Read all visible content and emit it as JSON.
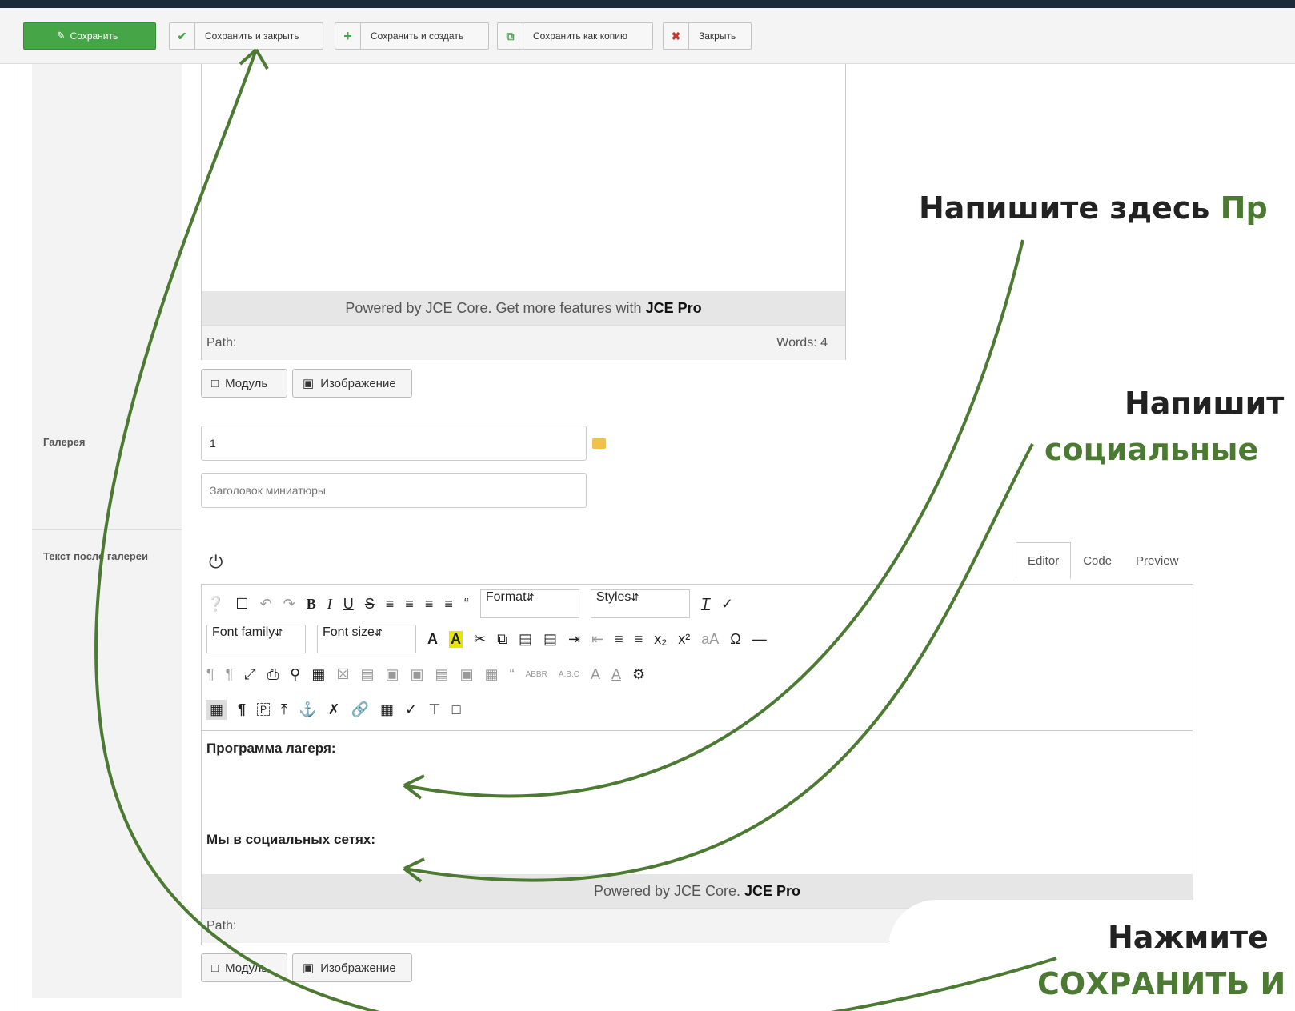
{
  "toolbar": {
    "save": "Сохранить",
    "save_close": "Сохранить и закрыть",
    "save_new": "Сохранить и создать",
    "save_copy": "Сохранить как копию",
    "close": "Закрыть"
  },
  "editor_top": {
    "powered_text": "Powered by JCE Core. Get more features with",
    "powered_bold": "JCE Pro",
    "path_label": "Path:",
    "words": "Words: 4"
  },
  "buttons": {
    "module": "Модуль",
    "image": "Изображение"
  },
  "gallery": {
    "label": "Галерея",
    "value": "1",
    "thumb_placeholder": "Заголовок миниатюры"
  },
  "after_gallery": {
    "label": "Текст после галереи",
    "tabs": [
      "Editor",
      "Code",
      "Preview"
    ],
    "format_select": "Format",
    "styles_select": "Styles",
    "font_family_select": "Font family",
    "font_size_select": "Font size",
    "content_line1": "Программа лагеря:",
    "content_line2": "Мы в социальных сетях:",
    "powered_text": "Powered by JCE Core.",
    "powered_bold": "JCE Pro",
    "path_label": "Path:"
  },
  "annotations": {
    "a1_black": "Напишите здесь ",
    "a1_green": "Пр",
    "a2_black": "Напишит",
    "a2_green": "социальные",
    "a3_black": "Нажмите",
    "a3_green": "СОХРАНИТЬ И"
  },
  "colors": {
    "save_green": "#46a546",
    "annotation_green": "#4c7a33",
    "arrow_green": "#4c7a33"
  }
}
